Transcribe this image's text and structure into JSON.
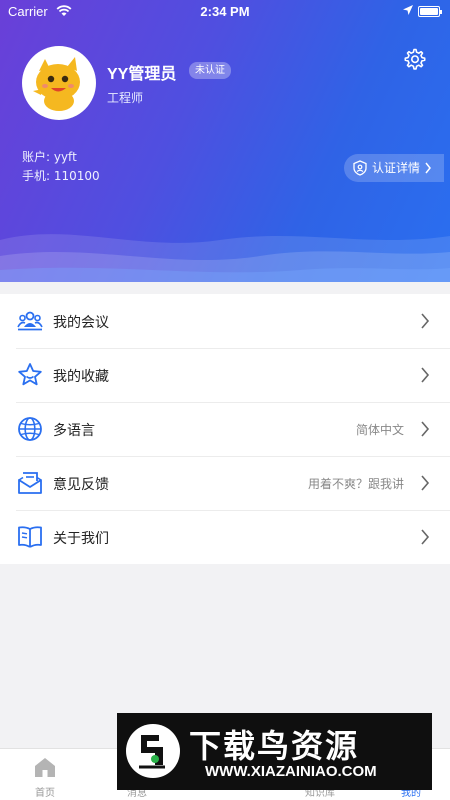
{
  "status_bar": {
    "carrier": "Carrier",
    "time": "2:34 PM"
  },
  "profile": {
    "name": "YY管理员",
    "badge": "未认证",
    "role": "工程师",
    "account": "账户: yyft",
    "phone": "手机: 110100",
    "verify_label": "认证详情"
  },
  "menu": [
    {
      "label": "我的会议",
      "value": "",
      "icon": "meeting-icon"
    },
    {
      "label": "我的收藏",
      "value": "",
      "icon": "star-icon"
    },
    {
      "label": "多语言",
      "value": "简体中文",
      "icon": "globe-icon"
    },
    {
      "label": "意见反馈",
      "value": "用着不爽？跟我讲",
      "icon": "feedback-icon"
    },
    {
      "label": "关于我们",
      "value": "",
      "icon": "book-icon"
    }
  ],
  "tabs": [
    {
      "label": "首页",
      "active": false
    },
    {
      "label": "消息",
      "active": false
    },
    {
      "label": "知识库",
      "active": false
    },
    {
      "label": "我的",
      "active": true
    }
  ],
  "watermark": {
    "title": "下载鸟资源",
    "url": "WWW.XIAZAINIAO.COM"
  },
  "colors": {
    "accent": "#2a6ff0",
    "header_start": "#6a3fd8",
    "header_end": "#2a6ff0"
  }
}
